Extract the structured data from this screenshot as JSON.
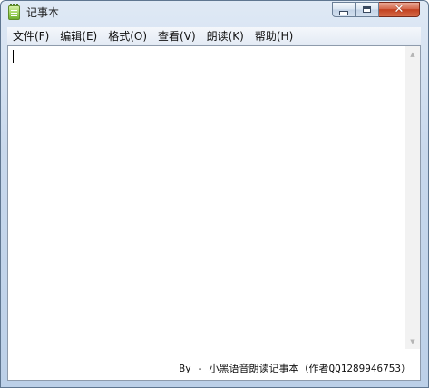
{
  "window": {
    "title": "记事本",
    "controls": {
      "minimize": "minimize",
      "maximize": "maximize",
      "close": "✕"
    }
  },
  "menu": {
    "items": [
      {
        "label": "文件(F)"
      },
      {
        "label": "编辑(E)"
      },
      {
        "label": "格式(O)"
      },
      {
        "label": "查看(V)"
      },
      {
        "label": "朗读(K)"
      },
      {
        "label": "帮助(H)"
      }
    ]
  },
  "editor": {
    "text": ""
  },
  "status": {
    "text": "By - 小黑语音朗读记事本（作者QQ1289946753）"
  }
}
